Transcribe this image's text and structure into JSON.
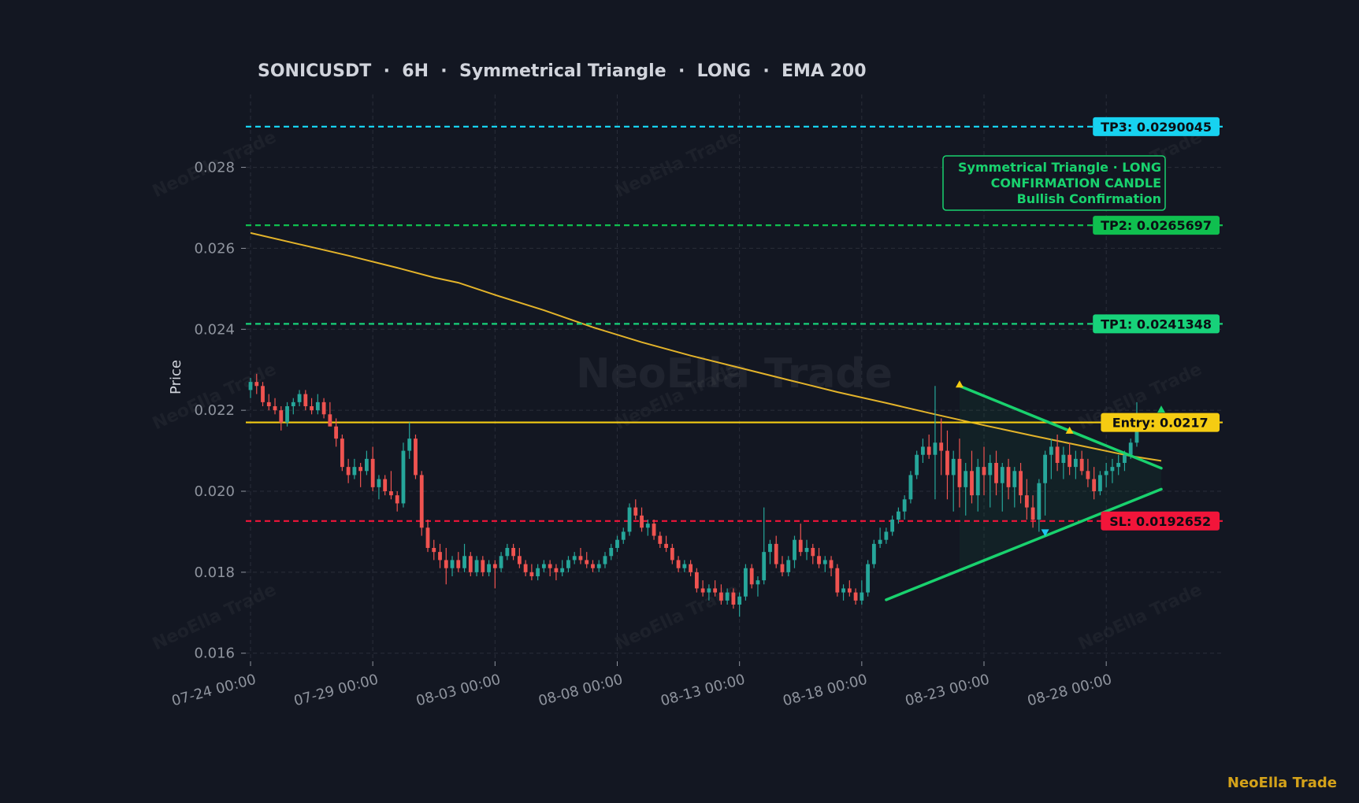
{
  "brand": "NeoElla Trade",
  "chart_data": {
    "type": "candlestick",
    "title": "SONICUSDT  ·  6H  ·  Symmetrical Triangle  ·  LONG  ·  EMA 200",
    "ylabel": "Price",
    "ylim": [
      0.0158,
      0.0298
    ],
    "y_ticks": [
      "0.016",
      "0.018",
      "0.020",
      "0.022",
      "0.024",
      "0.026",
      "0.028"
    ],
    "x_ticks": [
      "07-24 00:00",
      "07-29 00:00",
      "08-03 00:00",
      "08-08 00:00",
      "08-13 00:00",
      "08-18 00:00",
      "08-23 00:00",
      "08-28 00:00"
    ],
    "x_start": "07-24 00:00",
    "x_end": "08-30 06:00",
    "candle_interval_hours": 6,
    "grid": true,
    "watermark": "NeoElla Trade",
    "levels": [
      {
        "name": "TP3",
        "label": "TP3: 0.0290045",
        "value": 0.0290045,
        "color": "#17d2f0",
        "style": "dashed"
      },
      {
        "name": "TP2",
        "label": "TP2: 0.0265697",
        "value": 0.0265697,
        "color": "#0fbf4f",
        "style": "dashed"
      },
      {
        "name": "TP1",
        "label": "TP1: 0.0241348",
        "value": 0.0241348,
        "color": "#17d27a",
        "style": "dashed"
      },
      {
        "name": "Entry",
        "label": "Entry: 0.0217",
        "value": 0.0217,
        "color": "#f5cc12",
        "style": "solid"
      },
      {
        "name": "SL",
        "label": "SL: 0.0192652",
        "value": 0.0192652,
        "color": "#f2153a",
        "style": "dashed"
      }
    ],
    "annotation": [
      "Symmetrical Triangle · LONG",
      "CONFIRMATION CANDLE",
      "Bullish Confirmation"
    ],
    "colors": {
      "up": "#26a69a",
      "down": "#ef5350",
      "ema": "#e3b32a",
      "triangle": "#19d26e"
    },
    "ema": [
      [
        "07-24 00:00",
        0.02638
      ],
      [
        "07-26 00:00",
        0.0261
      ],
      [
        "07-28 00:00",
        0.02582
      ],
      [
        "07-30 00:00",
        0.02552
      ],
      [
        "07-31 12:00",
        0.02528
      ],
      [
        "08-01 12:00",
        0.02515
      ],
      [
        "08-03 00:00",
        0.02485
      ],
      [
        "08-05 00:00",
        0.02447
      ],
      [
        "08-07 00:00",
        0.02405
      ],
      [
        "08-09 00:00",
        0.02368
      ],
      [
        "08-11 00:00",
        0.02335
      ],
      [
        "08-13 00:00",
        0.02305
      ],
      [
        "08-15 00:00",
        0.02275
      ],
      [
        "08-17 00:00",
        0.02245
      ],
      [
        "08-19 00:00",
        0.02218
      ],
      [
        "08-21 00:00",
        0.0219
      ],
      [
        "08-23 00:00",
        0.02163
      ],
      [
        "08-25 00:00",
        0.02137
      ],
      [
        "08-27 00:00",
        0.02112
      ],
      [
        "08-29 00:00",
        0.02087
      ],
      [
        "08-30 06:00",
        0.02075
      ]
    ],
    "triangle": {
      "upper": [
        [
          "08-22 00:00",
          0.0226
        ],
        [
          "08-30 06:00",
          0.02057
        ]
      ],
      "lower": [
        [
          "08-19 00:00",
          0.01732
        ],
        [
          "08-30 06:00",
          0.02005
        ]
      ]
    },
    "markers": [
      {
        "time": "08-22 00:00",
        "value": 0.02262,
        "dir": "up",
        "color": "#f5cc12"
      },
      {
        "time": "08-26 12:00",
        "value": 0.02148,
        "dir": "up",
        "color": "#f5cc12"
      },
      {
        "time": "08-25 12:00",
        "value": 0.019,
        "dir": "down",
        "color": "#1ec8f0"
      },
      {
        "time": "08-30 06:00",
        "value": 0.022,
        "dir": "up",
        "color": "#19d26e"
      }
    ],
    "candles": [
      [
        "07-24 00:00",
        0.0225,
        0.0228,
        0.0223,
        0.0227
      ],
      [
        "07-24 06:00",
        0.0227,
        0.0229,
        0.0224,
        0.0226
      ],
      [
        "07-24 12:00",
        0.0226,
        0.0227,
        0.0221,
        0.0222
      ],
      [
        "07-24 18:00",
        0.0222,
        0.0224,
        0.022,
        0.0221
      ],
      [
        "07-25 00:00",
        0.0221,
        0.0223,
        0.0219,
        0.022
      ],
      [
        "07-25 06:00",
        0.022,
        0.0221,
        0.0215,
        0.0217
      ],
      [
        "07-25 12:00",
        0.0217,
        0.0222,
        0.0216,
        0.0221
      ],
      [
        "07-25 18:00",
        0.0221,
        0.0223,
        0.0219,
        0.0222
      ],
      [
        "07-26 00:00",
        0.0222,
        0.0225,
        0.0221,
        0.0224
      ],
      [
        "07-26 06:00",
        0.0224,
        0.0225,
        0.022,
        0.0221
      ],
      [
        "07-26 12:00",
        0.0221,
        0.0223,
        0.0219,
        0.022
      ],
      [
        "07-26 18:00",
        0.022,
        0.0224,
        0.0219,
        0.0222
      ],
      [
        "07-27 00:00",
        0.0222,
        0.0223,
        0.0218,
        0.0219
      ],
      [
        "07-27 06:00",
        0.0219,
        0.0222,
        0.0217,
        0.0216
      ],
      [
        "07-27 12:00",
        0.0216,
        0.0218,
        0.0211,
        0.0213
      ],
      [
        "07-27 18:00",
        0.0213,
        0.0214,
        0.0205,
        0.0206
      ],
      [
        "07-28 00:00",
        0.0206,
        0.0208,
        0.0202,
        0.0204
      ],
      [
        "07-28 06:00",
        0.0204,
        0.0208,
        0.0203,
        0.0206
      ],
      [
        "07-28 12:00",
        0.0206,
        0.0207,
        0.0201,
        0.0205
      ],
      [
        "07-28 18:00",
        0.0205,
        0.021,
        0.0204,
        0.0208
      ],
      [
        "07-29 00:00",
        0.0208,
        0.0211,
        0.02,
        0.0201
      ],
      [
        "07-29 06:00",
        0.0201,
        0.0204,
        0.0198,
        0.0203
      ],
      [
        "07-29 12:00",
        0.0203,
        0.0204,
        0.0199,
        0.02
      ],
      [
        "07-29 18:00",
        0.02,
        0.0205,
        0.0198,
        0.0199
      ],
      [
        "07-30 00:00",
        0.0199,
        0.02,
        0.0195,
        0.0197
      ],
      [
        "07-30 06:00",
        0.0197,
        0.0212,
        0.0196,
        0.021
      ],
      [
        "07-30 12:00",
        0.021,
        0.0217,
        0.0208,
        0.0213
      ],
      [
        "07-30 18:00",
        0.0213,
        0.0214,
        0.0203,
        0.0204
      ],
      [
        "07-31 00:00",
        0.0204,
        0.0205,
        0.0189,
        0.0191
      ],
      [
        "07-31 06:00",
        0.0191,
        0.0193,
        0.0185,
        0.0186
      ],
      [
        "07-31 12:00",
        0.0186,
        0.0188,
        0.0183,
        0.0185
      ],
      [
        "07-31 18:00",
        0.0185,
        0.0187,
        0.0181,
        0.0183
      ],
      [
        "08-01 00:00",
        0.0183,
        0.0186,
        0.0177,
        0.0181
      ],
      [
        "08-01 06:00",
        0.0181,
        0.0184,
        0.0179,
        0.0183
      ],
      [
        "08-01 12:00",
        0.0183,
        0.0185,
        0.018,
        0.0181
      ],
      [
        "08-01 18:00",
        0.0181,
        0.0187,
        0.018,
        0.0184
      ],
      [
        "08-02 00:00",
        0.0184,
        0.0185,
        0.0179,
        0.018
      ],
      [
        "08-02 06:00",
        0.018,
        0.0184,
        0.0179,
        0.0183
      ],
      [
        "08-02 12:00",
        0.0183,
        0.0184,
        0.0179,
        0.018
      ],
      [
        "08-02 18:00",
        0.018,
        0.0183,
        0.0179,
        0.0182
      ],
      [
        "08-03 00:00",
        0.0182,
        0.0183,
        0.0176,
        0.0181
      ],
      [
        "08-03 06:00",
        0.0181,
        0.0185,
        0.018,
        0.0184
      ],
      [
        "08-03 12:00",
        0.0184,
        0.0187,
        0.0183,
        0.0186
      ],
      [
        "08-03 18:00",
        0.0186,
        0.0187,
        0.0183,
        0.0184
      ],
      [
        "08-04 00:00",
        0.0184,
        0.0186,
        0.0181,
        0.0182
      ],
      [
        "08-04 06:00",
        0.0182,
        0.0183,
        0.0179,
        0.018
      ],
      [
        "08-04 12:00",
        0.018,
        0.0182,
        0.0178,
        0.0179
      ],
      [
        "08-04 18:00",
        0.0179,
        0.0182,
        0.0178,
        0.0181
      ],
      [
        "08-05 00:00",
        0.0181,
        0.0183,
        0.018,
        0.0182
      ],
      [
        "08-05 06:00",
        0.0182,
        0.0183,
        0.0179,
        0.0181
      ],
      [
        "08-05 12:00",
        0.0181,
        0.0182,
        0.0178,
        0.018
      ],
      [
        "08-05 18:00",
        0.018,
        0.0183,
        0.0179,
        0.0181
      ],
      [
        "08-06 00:00",
        0.0181,
        0.0184,
        0.018,
        0.0183
      ],
      [
        "08-06 06:00",
        0.0183,
        0.0185,
        0.0182,
        0.0184
      ],
      [
        "08-06 12:00",
        0.0184,
        0.0186,
        0.0182,
        0.0183
      ],
      [
        "08-06 18:00",
        0.0183,
        0.0185,
        0.0181,
        0.0182
      ],
      [
        "08-07 00:00",
        0.0182,
        0.0183,
        0.018,
        0.0181
      ],
      [
        "08-07 06:00",
        0.0181,
        0.0183,
        0.018,
        0.0182
      ],
      [
        "08-07 12:00",
        0.0182,
        0.0185,
        0.0181,
        0.0184
      ],
      [
        "08-07 18:00",
        0.0184,
        0.0187,
        0.0183,
        0.0186
      ],
      [
        "08-08 00:00",
        0.0186,
        0.0189,
        0.0185,
        0.0188
      ],
      [
        "08-08 06:00",
        0.0188,
        0.0191,
        0.0187,
        0.019
      ],
      [
        "08-08 12:00",
        0.019,
        0.0197,
        0.0189,
        0.0196
      ],
      [
        "08-08 18:00",
        0.0196,
        0.0198,
        0.0193,
        0.0194
      ],
      [
        "08-09 00:00",
        0.0194,
        0.0196,
        0.019,
        0.0191
      ],
      [
        "08-09 06:00",
        0.0191,
        0.0193,
        0.0189,
        0.0192
      ],
      [
        "08-09 12:00",
        0.0192,
        0.0193,
        0.0188,
        0.0189
      ],
      [
        "08-09 18:00",
        0.0189,
        0.019,
        0.0186,
        0.0187
      ],
      [
        "08-10 00:00",
        0.0187,
        0.0189,
        0.0185,
        0.0186
      ],
      [
        "08-10 06:00",
        0.0186,
        0.0187,
        0.0182,
        0.0183
      ],
      [
        "08-10 12:00",
        0.0183,
        0.0184,
        0.018,
        0.0181
      ],
      [
        "08-10 18:00",
        0.0181,
        0.0183,
        0.018,
        0.0182
      ],
      [
        "08-11 00:00",
        0.0182,
        0.0183,
        0.0179,
        0.018
      ],
      [
        "08-11 06:00",
        0.018,
        0.0181,
        0.0175,
        0.0176
      ],
      [
        "08-11 12:00",
        0.0176,
        0.0178,
        0.0174,
        0.0175
      ],
      [
        "08-11 18:00",
        0.0175,
        0.0177,
        0.0173,
        0.0176
      ],
      [
        "08-12 00:00",
        0.0176,
        0.0178,
        0.0174,
        0.0175
      ],
      [
        "08-12 06:00",
        0.0175,
        0.0177,
        0.0172,
        0.0173
      ],
      [
        "08-12 12:00",
        0.0173,
        0.0176,
        0.0172,
        0.0175
      ],
      [
        "08-12 18:00",
        0.0175,
        0.0176,
        0.0171,
        0.0172
      ],
      [
        "08-13 00:00",
        0.0172,
        0.0175,
        0.0169,
        0.0174
      ],
      [
        "08-13 06:00",
        0.0174,
        0.0182,
        0.0173,
        0.0181
      ],
      [
        "08-13 12:00",
        0.0181,
        0.0182,
        0.0176,
        0.0177
      ],
      [
        "08-13 18:00",
        0.0177,
        0.0179,
        0.0174,
        0.0178
      ],
      [
        "08-14 00:00",
        0.0178,
        0.0196,
        0.0177,
        0.0185
      ],
      [
        "08-14 06:00",
        0.0185,
        0.0188,
        0.0182,
        0.0187
      ],
      [
        "08-14 12:00",
        0.0187,
        0.0189,
        0.0181,
        0.0182
      ],
      [
        "08-14 18:00",
        0.0182,
        0.0184,
        0.0179,
        0.018
      ],
      [
        "08-15 00:00",
        0.018,
        0.0184,
        0.0179,
        0.0183
      ],
      [
        "08-15 06:00",
        0.0183,
        0.0189,
        0.0181,
        0.0188
      ],
      [
        "08-15 12:00",
        0.0188,
        0.0192,
        0.0184,
        0.0185
      ],
      [
        "08-15 18:00",
        0.0185,
        0.0188,
        0.0183,
        0.0186
      ],
      [
        "08-16 00:00",
        0.0186,
        0.0187,
        0.0182,
        0.0184
      ],
      [
        "08-16 06:00",
        0.0184,
        0.0186,
        0.0181,
        0.0182
      ],
      [
        "08-16 12:00",
        0.0182,
        0.0184,
        0.018,
        0.0183
      ],
      [
        "08-16 18:00",
        0.0183,
        0.0184,
        0.0179,
        0.0181
      ],
      [
        "08-17 00:00",
        0.0181,
        0.0182,
        0.0174,
        0.0175
      ],
      [
        "08-17 06:00",
        0.0175,
        0.0177,
        0.0173,
        0.0176
      ],
      [
        "08-17 12:00",
        0.0176,
        0.0178,
        0.0174,
        0.0175
      ],
      [
        "08-17 18:00",
        0.0175,
        0.0176,
        0.0172,
        0.0173
      ],
      [
        "08-18 00:00",
        0.0173,
        0.0178,
        0.0172,
        0.0175
      ],
      [
        "08-18 06:00",
        0.0175,
        0.0183,
        0.0174,
        0.0182
      ],
      [
        "08-18 12:00",
        0.0182,
        0.0188,
        0.0181,
        0.0187
      ],
      [
        "08-18 18:00",
        0.0187,
        0.0191,
        0.0186,
        0.0188
      ],
      [
        "08-19 00:00",
        0.0188,
        0.0191,
        0.0187,
        0.019
      ],
      [
        "08-19 06:00",
        0.019,
        0.0194,
        0.0189,
        0.0193
      ],
      [
        "08-19 12:00",
        0.0193,
        0.0196,
        0.0192,
        0.0195
      ],
      [
        "08-19 18:00",
        0.0195,
        0.0199,
        0.0193,
        0.0198
      ],
      [
        "08-20 00:00",
        0.0198,
        0.0205,
        0.0197,
        0.0204
      ],
      [
        "08-20 06:00",
        0.0204,
        0.021,
        0.0203,
        0.0209
      ],
      [
        "08-20 12:00",
        0.0209,
        0.0213,
        0.0207,
        0.0211
      ],
      [
        "08-20 18:00",
        0.0211,
        0.0214,
        0.0208,
        0.0209
      ],
      [
        "08-21 00:00",
        0.0209,
        0.0226,
        0.0198,
        0.0212
      ],
      [
        "08-21 06:00",
        0.0212,
        0.0218,
        0.0204,
        0.021
      ],
      [
        "08-21 12:00",
        0.021,
        0.0215,
        0.0198,
        0.0204
      ],
      [
        "08-21 18:00",
        0.0204,
        0.021,
        0.0195,
        0.0208
      ],
      [
        "08-22 00:00",
        0.0208,
        0.0213,
        0.0196,
        0.0201
      ],
      [
        "08-22 06:00",
        0.0201,
        0.0207,
        0.0194,
        0.0205
      ],
      [
        "08-22 12:00",
        0.0205,
        0.021,
        0.0197,
        0.0199
      ],
      [
        "08-22 18:00",
        0.0199,
        0.0208,
        0.0195,
        0.0206
      ],
      [
        "08-23 00:00",
        0.0206,
        0.0211,
        0.0199,
        0.0204
      ],
      [
        "08-23 06:00",
        0.0204,
        0.0209,
        0.0196,
        0.0207
      ],
      [
        "08-23 12:00",
        0.0207,
        0.021,
        0.0199,
        0.0202
      ],
      [
        "08-23 18:00",
        0.0202,
        0.0207,
        0.0195,
        0.0206
      ],
      [
        "08-24 00:00",
        0.0206,
        0.0208,
        0.0198,
        0.0201
      ],
      [
        "08-24 06:00",
        0.0201,
        0.0206,
        0.0196,
        0.0205
      ],
      [
        "08-24 12:00",
        0.0205,
        0.0207,
        0.0197,
        0.0199
      ],
      [
        "08-24 18:00",
        0.0199,
        0.0203,
        0.0193,
        0.0196
      ],
      [
        "08-25 00:00",
        0.0196,
        0.0199,
        0.0191,
        0.0193
      ],
      [
        "08-25 06:00",
        0.0193,
        0.0203,
        0.019,
        0.0202
      ],
      [
        "08-25 12:00",
        0.0202,
        0.021,
        0.0194,
        0.0209
      ],
      [
        "08-25 18:00",
        0.0209,
        0.0213,
        0.0203,
        0.0211
      ],
      [
        "08-26 00:00",
        0.0211,
        0.0214,
        0.0205,
        0.0207
      ],
      [
        "08-26 06:00",
        0.0207,
        0.0211,
        0.0203,
        0.0209
      ],
      [
        "08-26 12:00",
        0.0209,
        0.0212,
        0.0204,
        0.0206
      ],
      [
        "08-26 18:00",
        0.0206,
        0.021,
        0.0203,
        0.0208
      ],
      [
        "08-27 00:00",
        0.0208,
        0.021,
        0.0204,
        0.0205
      ],
      [
        "08-27 06:00",
        0.0205,
        0.0208,
        0.0201,
        0.0203
      ],
      [
        "08-27 12:00",
        0.0203,
        0.0206,
        0.0198,
        0.02
      ],
      [
        "08-27 18:00",
        0.02,
        0.0205,
        0.0199,
        0.0204
      ],
      [
        "08-28 00:00",
        0.0204,
        0.0207,
        0.0201,
        0.0205
      ],
      [
        "08-28 06:00",
        0.0205,
        0.0208,
        0.0202,
        0.0206
      ],
      [
        "08-28 12:00",
        0.0206,
        0.0209,
        0.0204,
        0.0207
      ],
      [
        "08-28 18:00",
        0.0207,
        0.021,
        0.0205,
        0.0209
      ],
      [
        "08-29 00:00",
        0.0209,
        0.0213,
        0.0208,
        0.0212
      ],
      [
        "08-29 06:00",
        0.0212,
        0.0222,
        0.0211,
        0.0218
      ]
    ]
  }
}
